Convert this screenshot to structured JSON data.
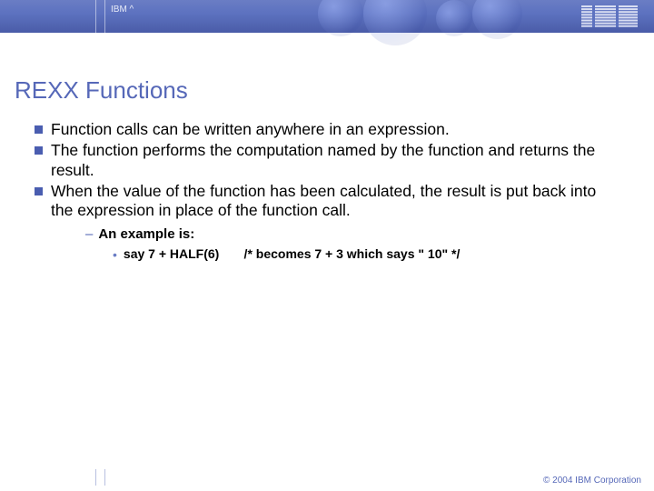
{
  "header": {
    "brand_label": "IBM ^",
    "logo_name": "IBM"
  },
  "title": "REXX Functions",
  "bullets": [
    "Function calls can be written anywhere in an expression.",
    "The function performs the computation named by the function and returns the result.",
    "When the value of the function has been calculated, the result is put back into the expression in place of the function call."
  ],
  "sub": {
    "intro": "An example is:",
    "code": "say 7 + HALF(6)       /* becomes 7 + 3 which says \" 10\" */"
  },
  "footer": {
    "copyright": "© 2004 IBM Corporation"
  }
}
